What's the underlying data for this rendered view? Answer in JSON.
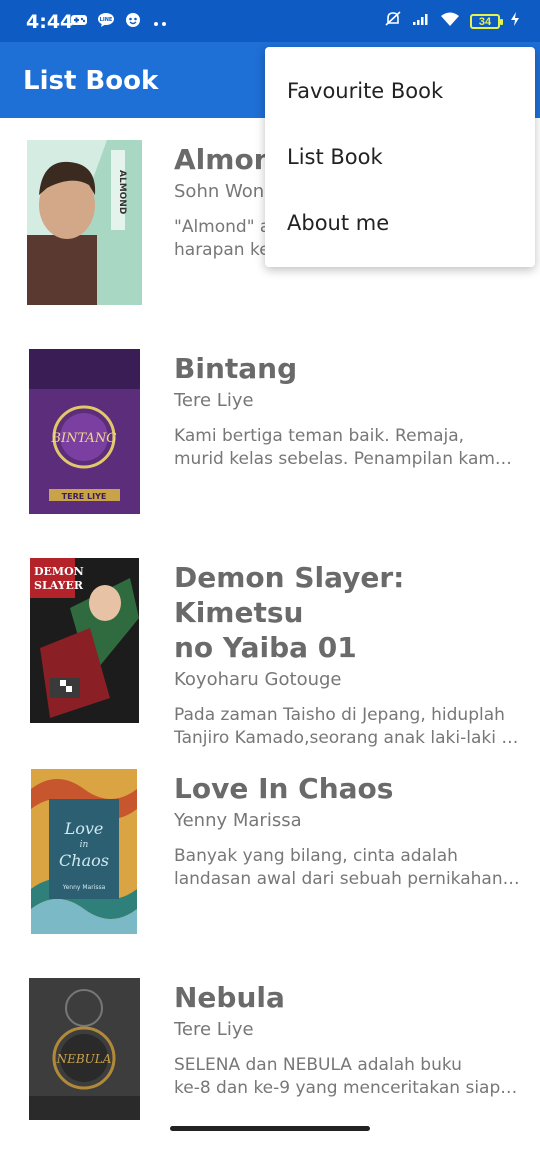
{
  "status_bar": {
    "time": "4:44",
    "battery": "34",
    "left_icons": [
      "gamepad-icon",
      "chat-bubble-icon",
      "face-badge-icon"
    ],
    "right_icons": [
      "mute-icon",
      "signal-icon",
      "wifi-icon",
      "battery-icon",
      "charging-icon"
    ]
  },
  "app_bar": {
    "title": "List Book"
  },
  "menu": {
    "items": [
      "Favourite Book",
      "List Book",
      "About me"
    ]
  },
  "books": [
    {
      "title": "Almond",
      "author": "Sohn Won",
      "desc_lines": [
        "\"Almond\" a",
        "harapan ke"
      ]
    },
    {
      "title": "Bintang",
      "author": "Tere Liye",
      "desc_lines": [
        "Kami bertiga teman baik. Remaja,",
        "murid kelas sebelas. Penampilan kam…"
      ]
    },
    {
      "title_lines": [
        "Demon Slayer: Kimetsu",
        "no Yaiba 01"
      ],
      "author": "Koyoharu Gotouge",
      "desc_lines": [
        "Pada zaman Taisho di Jepang, hiduplah",
        "Tanjiro Kamado,seorang anak laki-laki …"
      ]
    },
    {
      "title": "Love In Chaos",
      "author": "Yenny Marissa",
      "desc_lines": [
        "Banyak yang bilang, cinta adalah",
        "landasan awal dari sebuah pernikahan…"
      ]
    },
    {
      "title": "Nebula",
      "author": "Tere Liye",
      "desc_lines": [
        "SELENA dan NEBULA adalah buku",
        "ke-8 dan ke-9 yang menceritakan siap…"
      ]
    }
  ],
  "colors": {
    "status_bar": "#0f5bc4",
    "app_bar": "#1e6fd6",
    "title_text": "#6a6a6a"
  }
}
